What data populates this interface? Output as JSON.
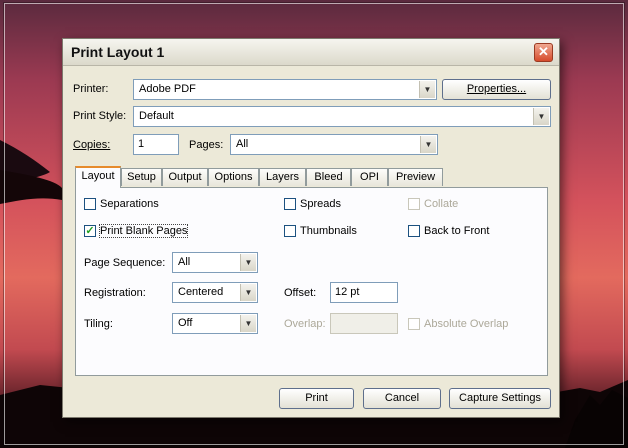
{
  "window": {
    "title": "Print Layout 1"
  },
  "printer": {
    "label": "Printer:",
    "value": "Adobe PDF",
    "properties_button": "Properties..."
  },
  "print_style": {
    "label": "Print Style:",
    "value": "Default"
  },
  "copies": {
    "label": "Copies:",
    "value": "1"
  },
  "pages": {
    "label": "Pages:",
    "value": "All"
  },
  "tabs": [
    "Layout",
    "Setup",
    "Output",
    "Options",
    "Layers",
    "Bleed",
    "OPI",
    "Preview"
  ],
  "layout": {
    "separations": {
      "label": "Separations",
      "checked": false
    },
    "spreads": {
      "label": "Spreads",
      "checked": false
    },
    "collate": {
      "label": "Collate",
      "checked": false,
      "enabled": false
    },
    "print_blank_pages": {
      "label": "Print Blank Pages",
      "checked": true
    },
    "thumbnails": {
      "label": "Thumbnails",
      "checked": false
    },
    "back_to_front": {
      "label": "Back to Front",
      "checked": false
    },
    "page_sequence": {
      "label": "Page Sequence:",
      "value": "All"
    },
    "registration": {
      "label": "Registration:",
      "value": "Centered"
    },
    "offset": {
      "label": "Offset:",
      "value": "12 pt"
    },
    "tiling": {
      "label": "Tiling:",
      "value": "Off"
    },
    "overlap": {
      "label": "Overlap:",
      "value": ""
    },
    "absolute_overlap": {
      "label": "Absolute Overlap",
      "checked": false,
      "enabled": false
    }
  },
  "buttons": {
    "print": "Print",
    "cancel": "Cancel",
    "capture": "Capture Settings"
  },
  "icons": {
    "close": "close-icon",
    "dropdown": "chevron-down-icon",
    "check": "checkmark-icon"
  },
  "colors": {
    "dialog_bg": "#ece9d8",
    "tab_accent": "#e68b2c",
    "close_btn": "#d64b2c"
  }
}
